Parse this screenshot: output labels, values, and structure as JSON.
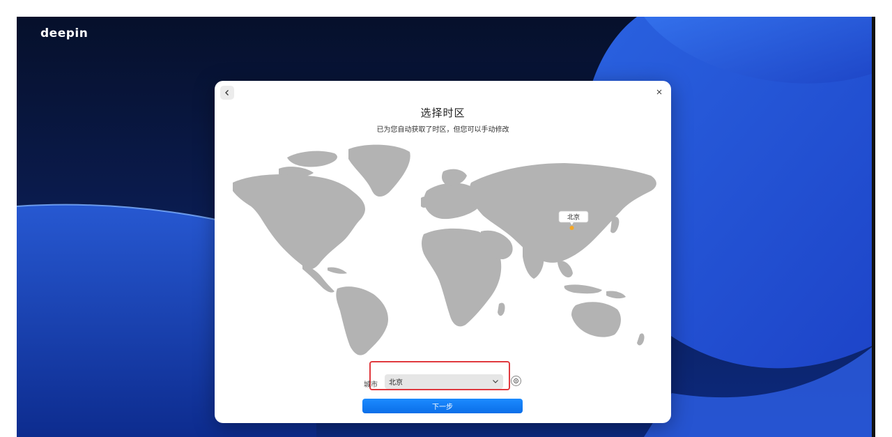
{
  "desktop": {
    "brand": "deepin"
  },
  "dialog": {
    "title": "选择时区",
    "subtitle": "已为您自动获取了时区，但您可以手动修改",
    "back_icon": "chevron-left-icon",
    "close_icon": "close-icon"
  },
  "map": {
    "marker_label": "北京",
    "land_color": "#b3b3b3",
    "marker_color": "#f5a623"
  },
  "form": {
    "city_label": "城市",
    "city_value": "北京",
    "dropdown_icon": "chevron-down-icon",
    "locate_icon": "locate-icon",
    "next_label": "下一步"
  },
  "colors": {
    "accent": "#0a6ee8",
    "highlight_border": "#e0393e"
  }
}
